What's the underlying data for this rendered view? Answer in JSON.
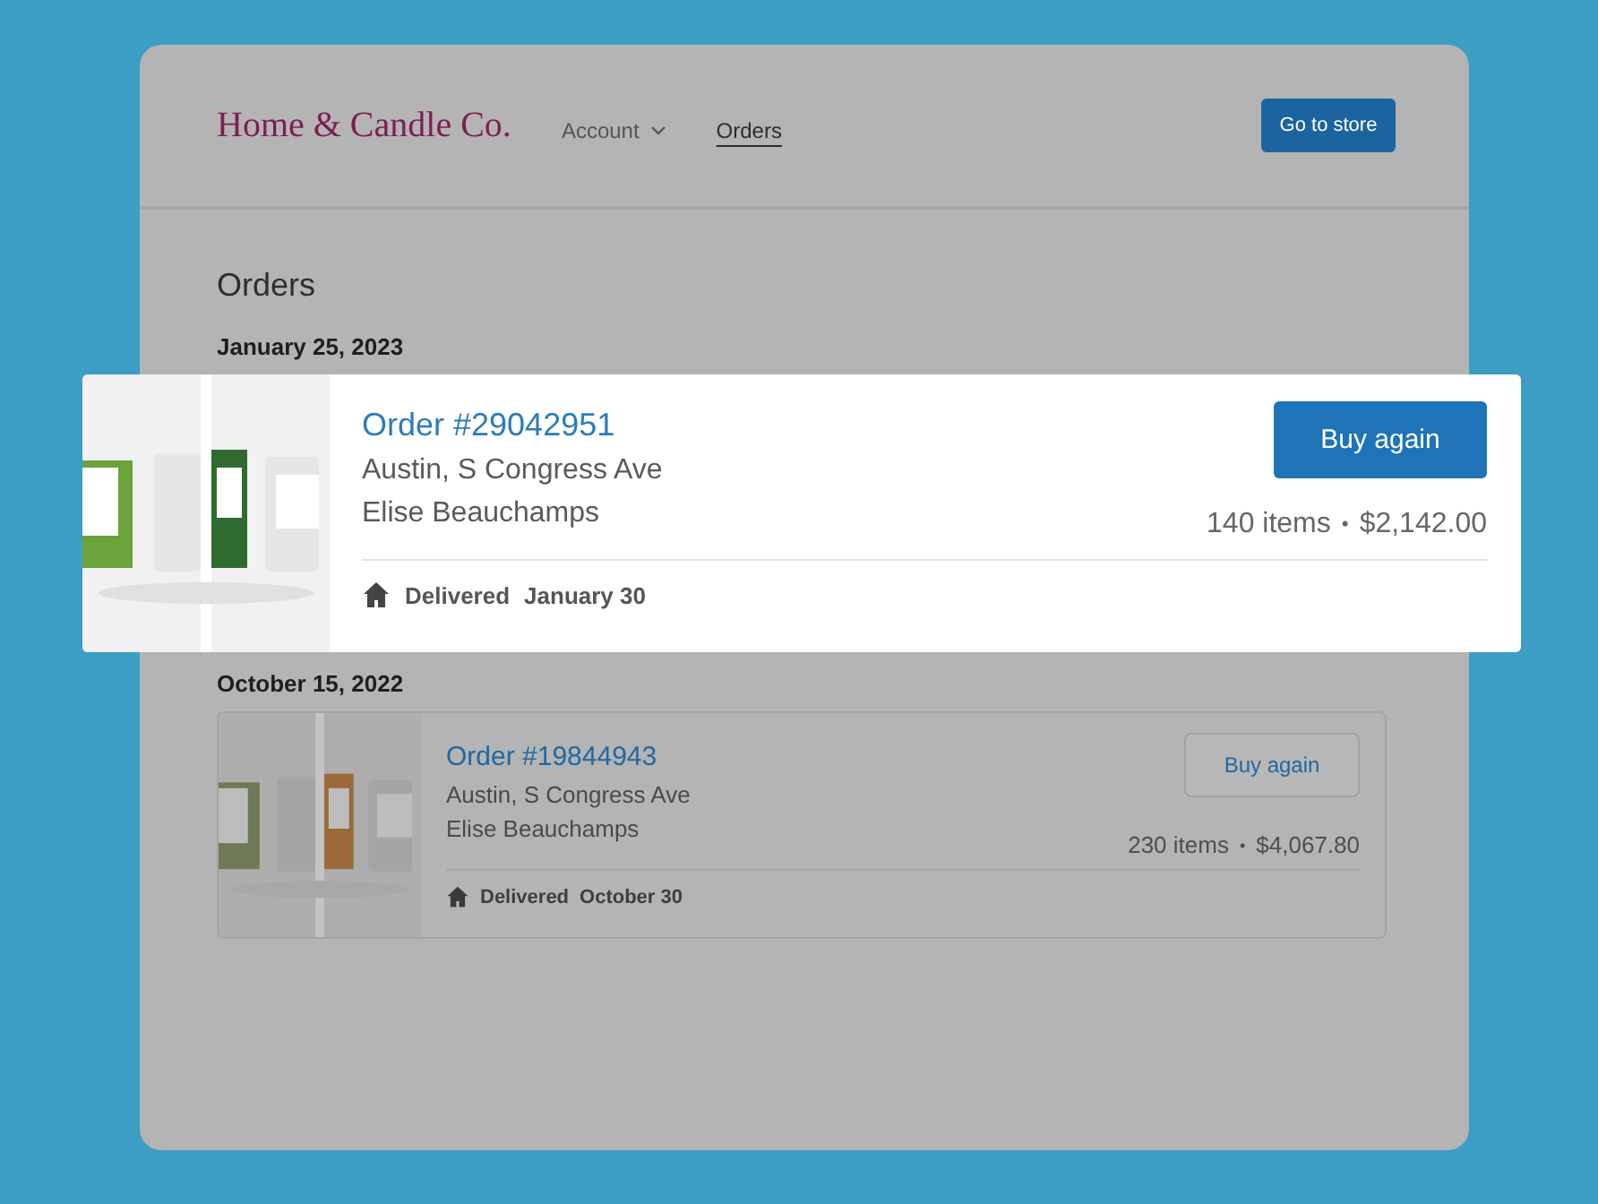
{
  "header": {
    "logo": "Home & Candle Co.",
    "nav": [
      {
        "label": "Account",
        "kind": "dropdown",
        "selected": false
      },
      {
        "label": "Orders",
        "kind": "link",
        "selected": true
      }
    ],
    "store_button": "Go to store"
  },
  "title": "Orders",
  "orders": [
    {
      "date": "January 25, 2023",
      "highlighted": true,
      "number": "Order #29042951",
      "address": "Austin, S Congress Ave",
      "customer": "Elise Beauchamps",
      "items": "140 items",
      "separator": "•",
      "total": "$2,142.00",
      "button": "Buy again",
      "status": "Delivered",
      "delivered_on": "January 30"
    },
    {
      "date": "October 15, 2022",
      "highlighted": false,
      "number": "Order #19844943",
      "address": "Austin, S Congress Ave",
      "customer": "Elise Beauchamps",
      "items": "230 items",
      "separator": "•",
      "total": "$4,067.80",
      "button": "Buy again",
      "status": "Delivered",
      "delivered_on": "October 30"
    }
  ]
}
